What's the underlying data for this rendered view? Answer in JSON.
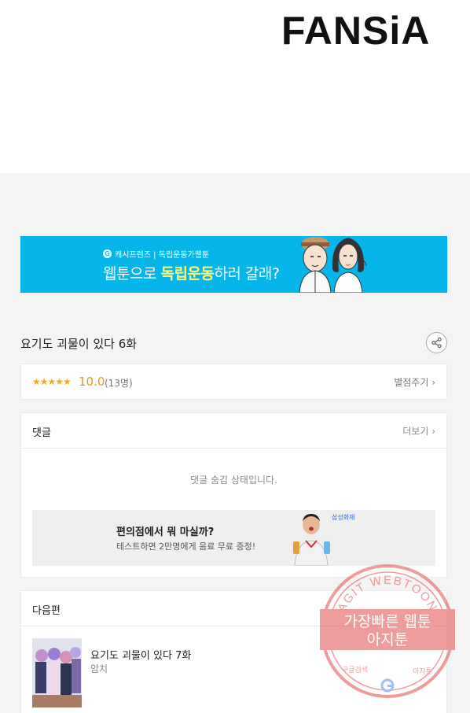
{
  "header": {
    "logo_text": "FANSiA"
  },
  "banner": {
    "brand_icon": "G",
    "brand": "캐시프렌즈 | 독립운동가웹툰",
    "title_plain": "웹툰으로 ",
    "title_bold": "독립운동",
    "title_rest": "하러 갈래?"
  },
  "episode": {
    "title": "요기도 괴물이 있다 6화"
  },
  "rating": {
    "stars": "★★★★★",
    "score": "10.0",
    "count": "(13명)",
    "rate_link": "별점주기 ›"
  },
  "comments": {
    "title": "댓글",
    "more": "더보기 ›",
    "hidden_message": "댓글 숨김 상태입니다.",
    "ad": {
      "title": "편의점에서 뭐 마실까?",
      "subtitle": "테스트하면 2만명에게 음료 무료 증정!",
      "brand": "삼성화재"
    }
  },
  "next": {
    "title": "다음편",
    "episode_title": "요기도 괴물이 있다 7화",
    "author": "암치"
  },
  "watermark": {
    "top": "AGIT WEBTOON",
    "middle1": "가장빠른 웹툰",
    "middle2": "아지툰",
    "bottom_left": "구글검색",
    "bottom_right": "아지툰"
  },
  "colors": {
    "banner_bg": "#06b6ea",
    "star": "#f5a623",
    "score": "#e79a1a",
    "watermark": "#e03c3c"
  },
  "icons": {
    "share": "share-icon",
    "google": "google-g-icon"
  }
}
